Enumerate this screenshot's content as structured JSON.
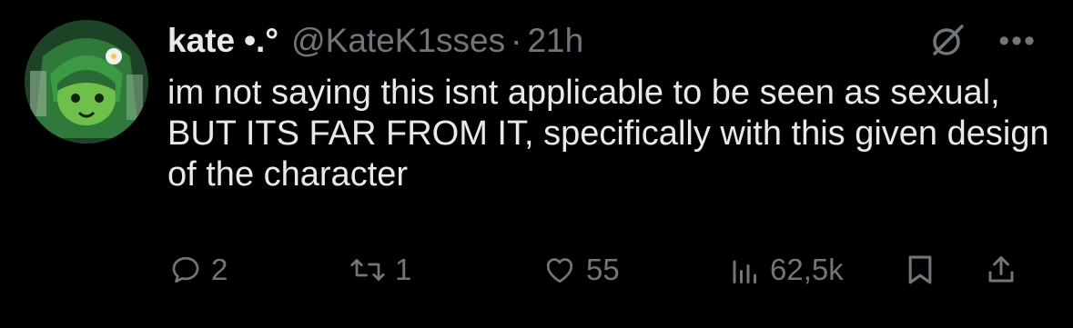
{
  "tweet": {
    "author": {
      "display_name": "kate",
      "name_decor": "•.°",
      "handle": "@KateK1sses",
      "separator": "·",
      "time": "21h"
    },
    "text": "im not saying this isnt applicable to be seen as sexual, BUT ITS FAR FROM IT, specifically with this given design of the character",
    "stats": {
      "replies": "2",
      "reposts": "1",
      "likes": "55",
      "views": "62,5k"
    },
    "icons": {
      "top_right": [
        "grok-icon",
        "more-icon"
      ],
      "actions": [
        "reply-icon",
        "repost-icon",
        "like-icon",
        "views-icon",
        "bookmark-icon",
        "share-icon"
      ]
    },
    "colors": {
      "background": "#000000",
      "primary_text": "#e7e9ea",
      "secondary_text": "#71767b"
    }
  }
}
